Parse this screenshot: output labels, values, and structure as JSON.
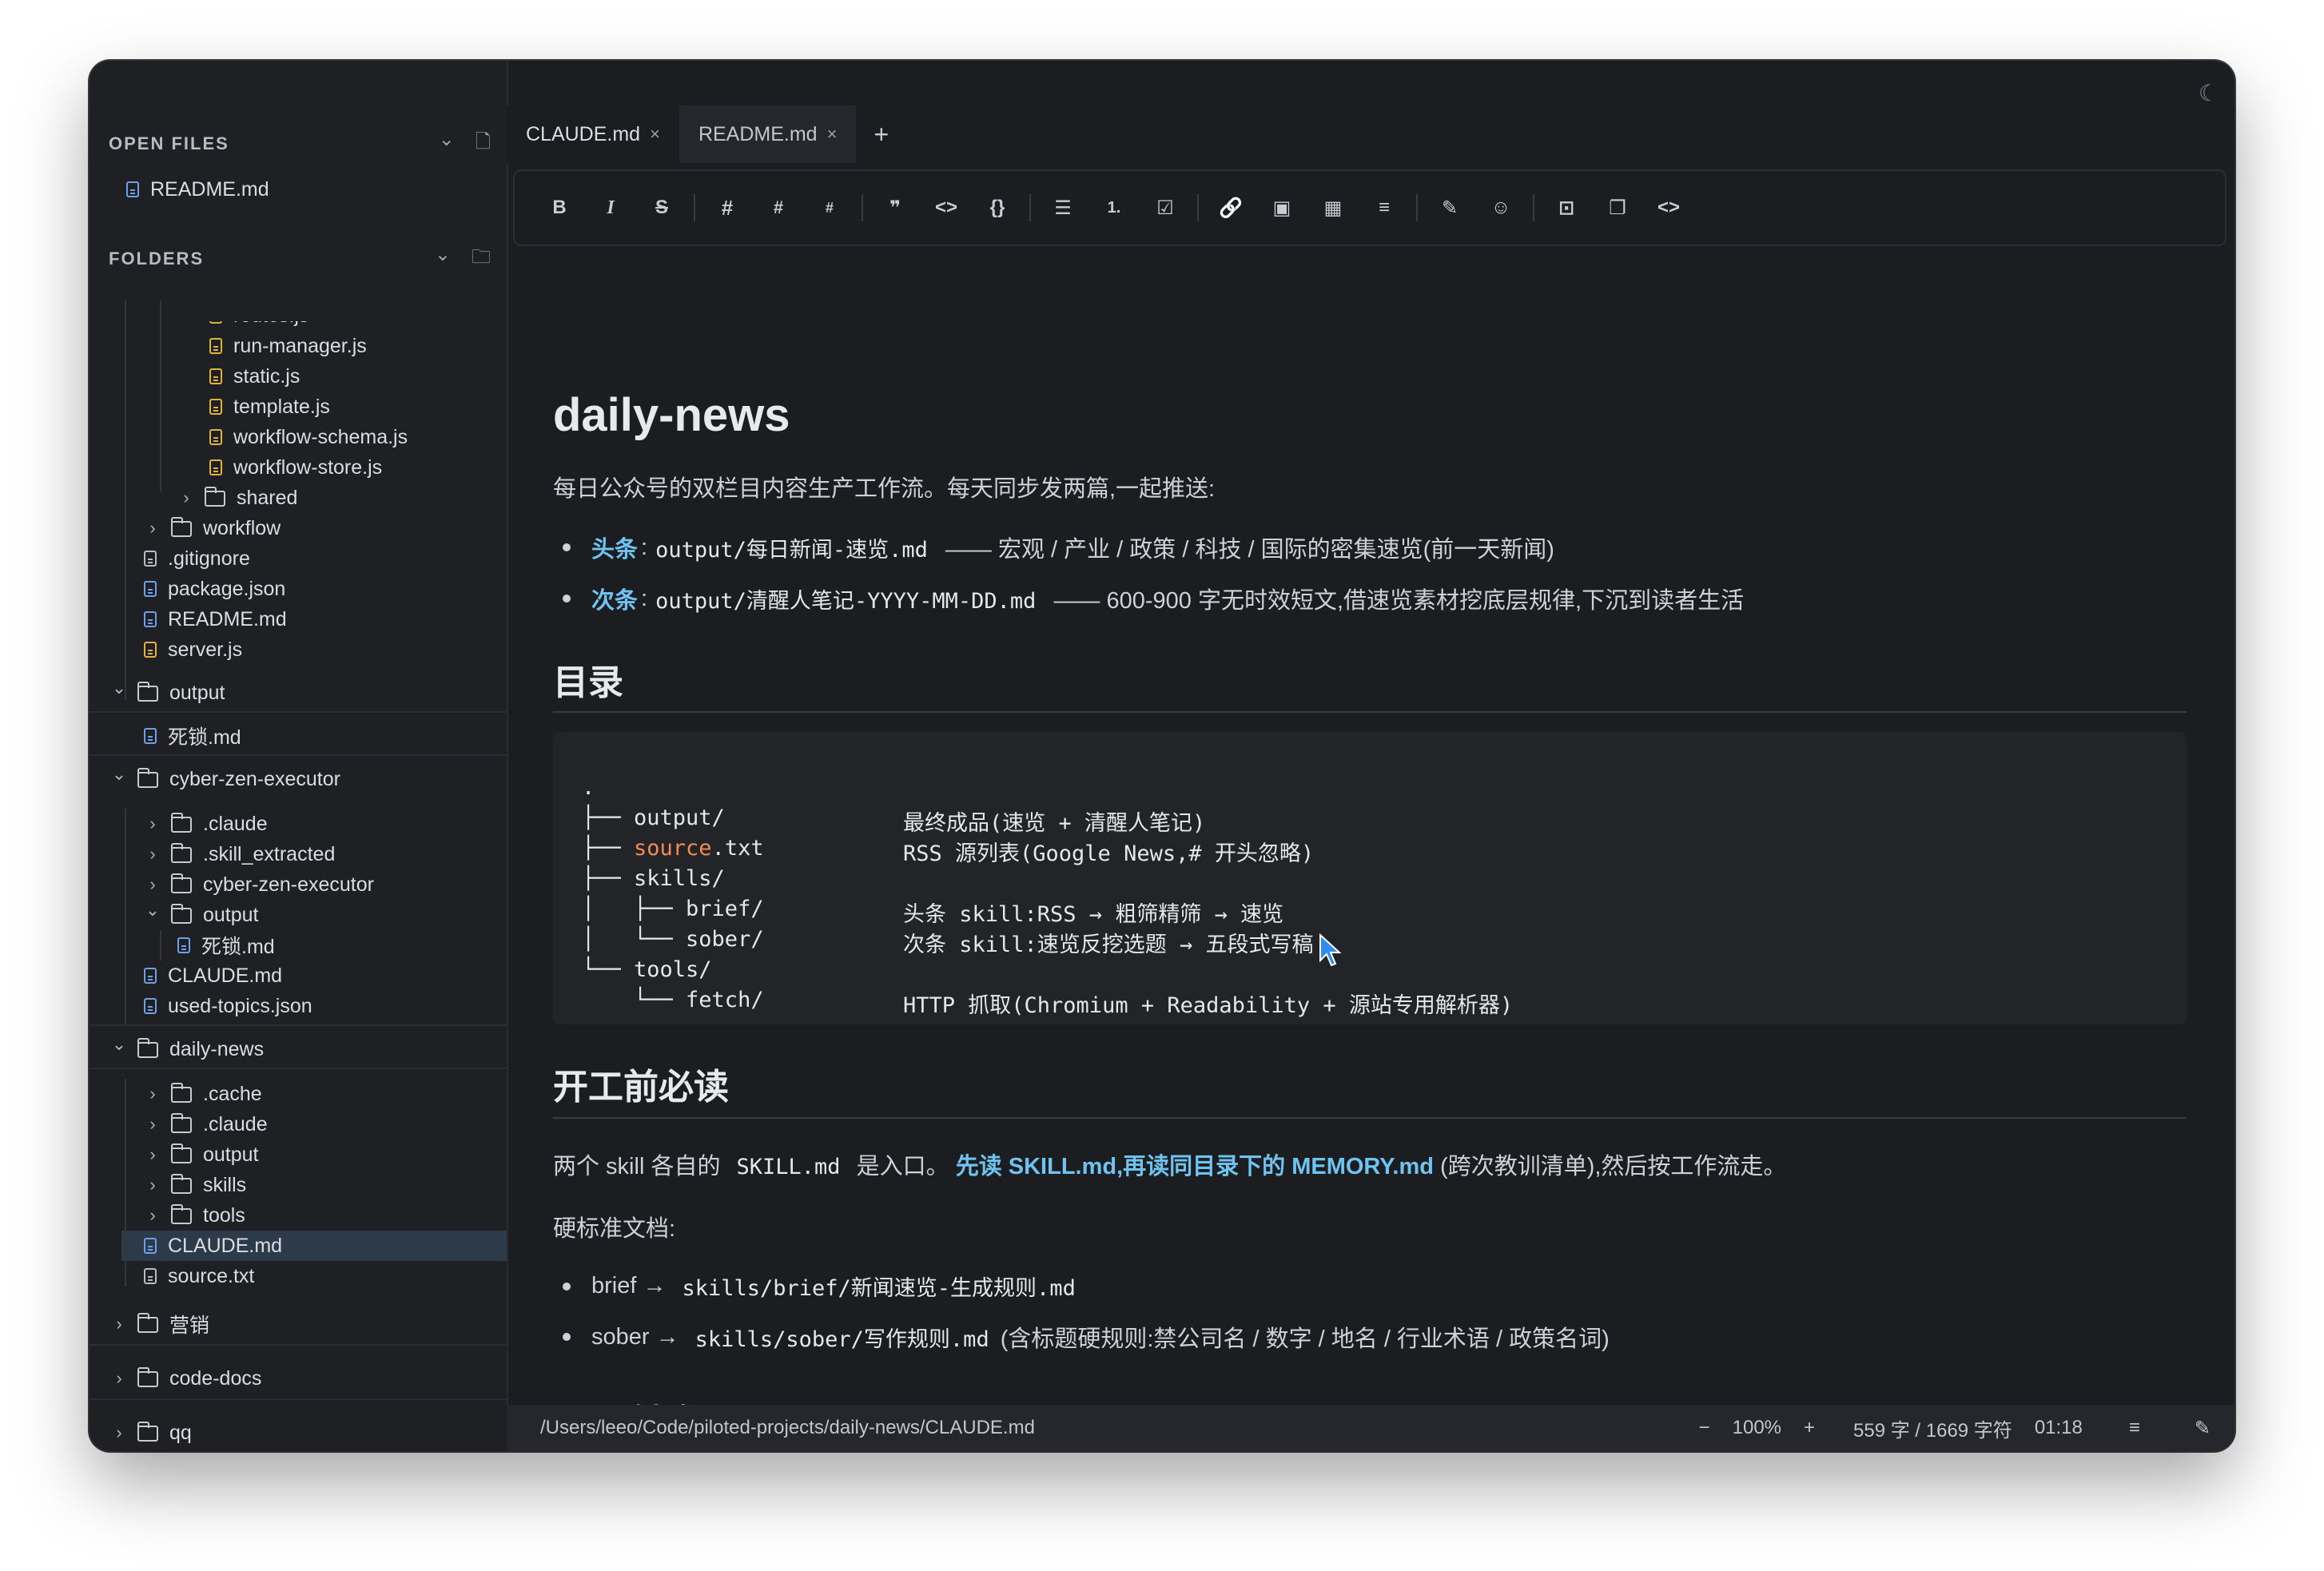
{
  "sidebar": {
    "open_files_header": "OPEN FILES",
    "open_files": [
      {
        "name": "README.md"
      }
    ],
    "folders_header": "FOLDERS",
    "tree": [
      {
        "name": "routes.js",
        "type": "js",
        "partial": true
      },
      {
        "name": "run-manager.js",
        "type": "js"
      },
      {
        "name": "static.js",
        "type": "js"
      },
      {
        "name": "template.js",
        "type": "js"
      },
      {
        "name": "workflow-schema.js",
        "type": "js"
      },
      {
        "name": "workflow-store.js",
        "type": "js"
      },
      {
        "name": "shared",
        "type": "folder"
      },
      {
        "name": "workflow",
        "type": "folder"
      },
      {
        "name": ".gitignore",
        "type": "plain"
      },
      {
        "name": "package.json",
        "type": "md"
      },
      {
        "name": "README.md",
        "type": "md"
      },
      {
        "name": "server.js",
        "type": "js"
      },
      {
        "name": "output",
        "type": "folder-open"
      },
      {
        "name": "死锁.md",
        "type": "md"
      },
      {
        "name": "cyber-zen-executor",
        "type": "folder-open"
      },
      {
        "name": ".claude",
        "type": "folder"
      },
      {
        "name": ".skill_extracted",
        "type": "folder"
      },
      {
        "name": "cyber-zen-executor",
        "type": "folder"
      },
      {
        "name": "output",
        "type": "folder-open"
      },
      {
        "name": "死锁.md",
        "type": "md"
      },
      {
        "name": "CLAUDE.md",
        "type": "md"
      },
      {
        "name": "used-topics.json",
        "type": "md"
      },
      {
        "name": "daily-news",
        "type": "folder-open"
      },
      {
        "name": ".cache",
        "type": "folder"
      },
      {
        "name": ".claude",
        "type": "folder"
      },
      {
        "name": "output",
        "type": "folder"
      },
      {
        "name": "skills",
        "type": "folder"
      },
      {
        "name": "tools",
        "type": "folder"
      },
      {
        "name": "CLAUDE.md",
        "type": "md",
        "selected": true
      },
      {
        "name": "source.txt",
        "type": "plain"
      },
      {
        "name": "营销",
        "type": "folder"
      },
      {
        "name": "code-docs",
        "type": "folder"
      },
      {
        "name": "qq",
        "type": "folder"
      }
    ]
  },
  "tabs": [
    {
      "label": "CLAUDE.md",
      "close": "×"
    },
    {
      "label": "README.md",
      "close": "×"
    }
  ],
  "tab_add": "+",
  "toolbar": {
    "bold": "B",
    "italic": "I",
    "strike": "S",
    "h1": "#",
    "h2": "#",
    "h3": "#",
    "quote": "❞",
    "inline_code": "<>",
    "code_block": "{}",
    "ul": "☰",
    "ol": "1.",
    "task": "☑",
    "link": "🔗",
    "image": "▣",
    "table": "▦",
    "hr": "≡",
    "highlight": "✎",
    "emoji": "☺",
    "focus": "⊡",
    "copy": "❐",
    "source": "<>"
  },
  "doc": {
    "title": "daily-news",
    "intro": "每日公众号的双栏目内容生产工作流。每天同步发两篇,一起推送:",
    "b1_label": "头条",
    "b1_sep": ":",
    "b1_code": "output/每日新闻-速览.md",
    "b1_text": "—— 宏观 / 产业 / 政策 / 科技 / 国际的密集速览(前一天新闻)",
    "b2_label": "次条",
    "b2_sep": ":",
    "b2_code": "output/清醒人笔记-YYYY-MM-DD.md",
    "b2_text": "—— 600-900 字无时效短文,借速览素材挖底层规律,下沉到读者生活",
    "h_toc": "目录",
    "code_lines": [
      {
        "tree": ".",
        "comment": ""
      },
      {
        "tree": "├── output/",
        "comment": "最终成品(速览 + 清醒人笔记)"
      },
      {
        "tree": "├── ",
        "kw": "source",
        "rest": ".txt",
        "comment": "RSS 源列表(Google News,# 开头忽略)"
      },
      {
        "tree": "├── skills/",
        "comment": ""
      },
      {
        "tree": "│   ├── brief/",
        "comment": "头条 skill:RSS → 粗筛精筛 → 速览"
      },
      {
        "tree": "│   └── sober/",
        "comment": "次条 skill:速览反挖选题 → 五段式写稿"
      },
      {
        "tree": "└── tools/",
        "comment": ""
      },
      {
        "tree": "    └── fetch/",
        "comment": "HTTP 抓取(Chromium + Readability + 源站专用解析器)"
      }
    ],
    "h_read": "开工前必读",
    "read_p1": "两个 skill 各自的",
    "read_code": "SKILL.md",
    "read_p2": "是入口。",
    "read_link": "先读 SKILL.md,再读同目录下的 MEMORY.md",
    "read_p3": "(跨次教训清单),然后按工作流走。",
    "std_label": "硬标准文档:",
    "std1_a": "brief →",
    "std1_code": "skills/brief/新闻速览-生成规则.md",
    "std2_a": "sober →",
    "std2_code": "skills/sober/写作规则.md",
    "std2_b": "(含标题硬规则:禁公司名 / 数字 / 地名 / 行业术语 / 政策名词)",
    "h_skill": "skill 触发词"
  },
  "status": {
    "path": "/Users/leeo/Code/piloted-projects/daily-news/CLAUDE.md",
    "zoom_minus": "−",
    "zoom": "100%",
    "zoom_plus": "+",
    "counts": "559 字 / 1669 字符",
    "time": "01:18",
    "menu": "≡",
    "edit": "✎"
  },
  "theme_icon": "☾"
}
